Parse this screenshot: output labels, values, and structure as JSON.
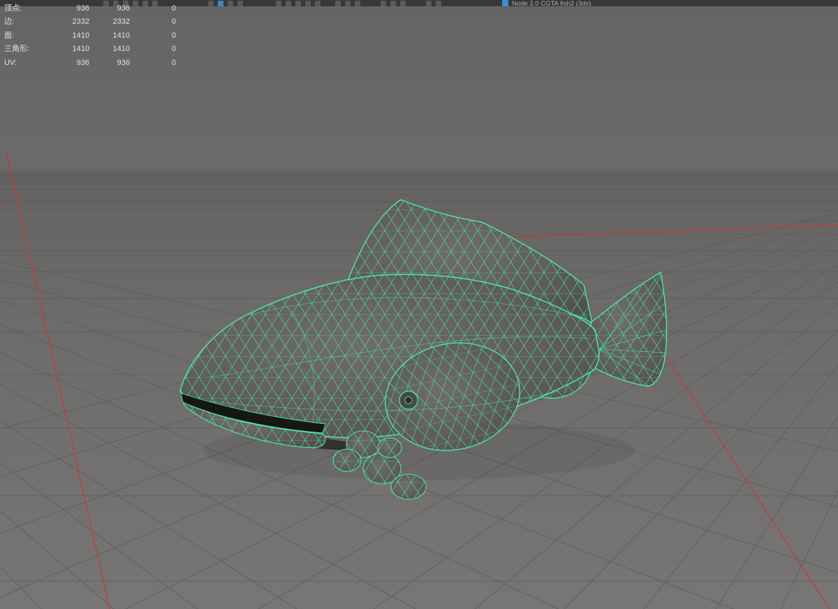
{
  "topbar": {
    "title": "Node 2.0 CGTA fish2 (3ds)"
  },
  "hud": {
    "rows": [
      {
        "label": "顶点:",
        "a": "936",
        "b": "936",
        "c": "0"
      },
      {
        "label": "边:",
        "a": "2332",
        "b": "2332",
        "c": "0"
      },
      {
        "label": "面:",
        "a": "1410",
        "b": "1410",
        "c": "0"
      },
      {
        "label": "三角形:",
        "a": "1410",
        "b": "1410",
        "c": "0"
      },
      {
        "label": "UV:",
        "a": "936",
        "b": "936",
        "c": "0"
      }
    ]
  },
  "colors": {
    "wireframe": "#4be9a4",
    "axis": "#c23b33",
    "background": "#696969"
  }
}
